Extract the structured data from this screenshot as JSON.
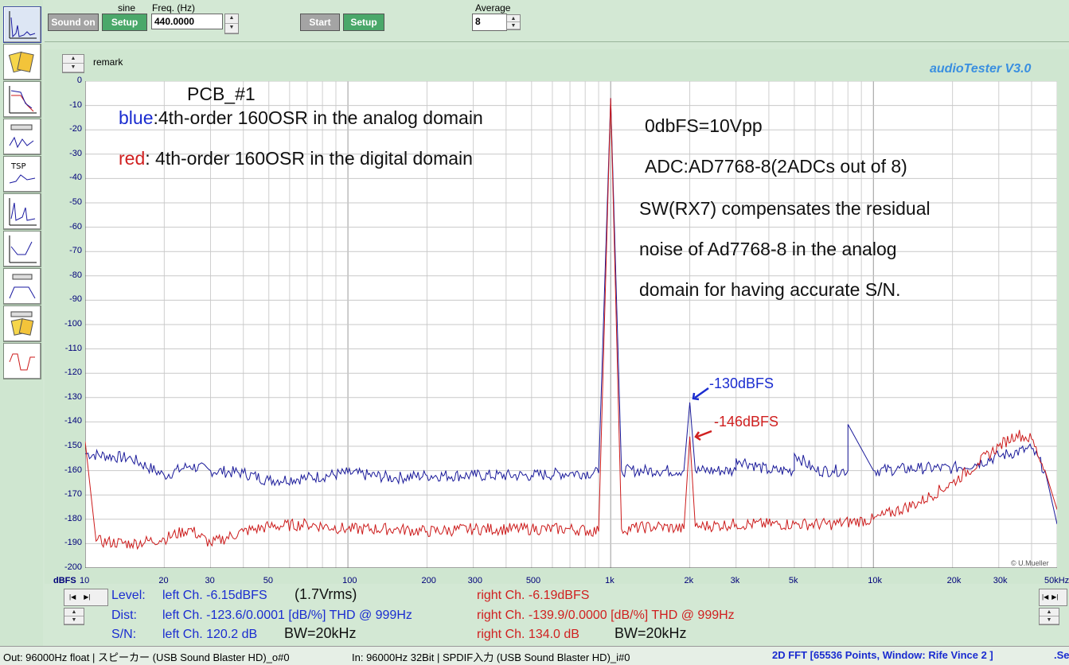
{
  "top": {
    "sound_on_label": "Sound on",
    "sine_label": "sine",
    "setup_label": "Setup",
    "freq_label": "Freq. (Hz)",
    "freq_value": "440.0000",
    "start_label": "Start",
    "setup2_label": "Setup",
    "average_label": "Average",
    "average_value": "8"
  },
  "header": {
    "remark_label": "remark",
    "app_title": "audioTester  V3.0"
  },
  "plot": {
    "y_ticks": [
      "0",
      "-10",
      "-20",
      "-30",
      "-40",
      "-50",
      "-60",
      "-70",
      "-80",
      "-90",
      "-100",
      "-110",
      "-120",
      "-130",
      "-140",
      "-150",
      "-160",
      "-170",
      "-180",
      "-190",
      "-200"
    ],
    "y_unit": "dBFS",
    "x_ticks": [
      "10",
      "20",
      "30",
      "50",
      "100",
      "200",
      "300",
      "500",
      "1k",
      "2k",
      "3k",
      "5k",
      "10k",
      "20k",
      "30k",
      "50kHz"
    ],
    "copyright": "© U.Mueller",
    "annotations": {
      "pcb": "PCB_#1",
      "blue_word": "blue",
      "blue_text": ":4th-order  160OSR in the analog domain",
      "red_word": "red",
      "red_text": ": 4th-order  160OSR in the digital domain",
      "fs": "0dbFS=10Vpp",
      "adc": "ADC:AD7768-8(2ADCs out of 8)",
      "sw1": "SW(RX7) compensates the residual",
      "sw2": "noise of Ad7768-8 in the analog",
      "sw3": "domain for having accurate S/N.",
      "blue_peak": "-130dBFS",
      "red_peak": "-146dBFS"
    }
  },
  "chart_data": {
    "type": "line",
    "title": "",
    "xlabel": "",
    "ylabel": "dBFS",
    "x_scale": "log",
    "xlim": [
      10,
      50000
    ],
    "ylim": [
      -200,
      0
    ],
    "grid": true,
    "series": [
      {
        "name": "blue",
        "color": "#1a1a9a",
        "points": [
          [
            10,
            -153
          ],
          [
            15,
            -155
          ],
          [
            20,
            -162
          ],
          [
            25,
            -158
          ],
          [
            30,
            -160
          ],
          [
            40,
            -161
          ],
          [
            50,
            -164
          ],
          [
            70,
            -163
          ],
          [
            100,
            -161
          ],
          [
            150,
            -163
          ],
          [
            200,
            -162
          ],
          [
            300,
            -162
          ],
          [
            500,
            -162
          ],
          [
            700,
            -161
          ],
          [
            900,
            -161
          ],
          [
            1000,
            -7
          ],
          [
            1100,
            -160
          ],
          [
            1500,
            -160
          ],
          [
            1900,
            -160
          ],
          [
            2000,
            -132
          ],
          [
            2100,
            -160
          ],
          [
            3000,
            -160
          ],
          [
            3000,
            -155
          ],
          [
            4000,
            -160
          ],
          [
            5000,
            -160
          ],
          [
            5000,
            -153
          ],
          [
            6000,
            -160
          ],
          [
            7000,
            -160
          ],
          [
            8000,
            -160
          ],
          [
            8000,
            -141
          ],
          [
            10000,
            -160
          ],
          [
            15000,
            -159
          ],
          [
            20000,
            -159
          ],
          [
            25000,
            -157
          ],
          [
            30000,
            -154
          ],
          [
            40000,
            -151
          ],
          [
            45000,
            -160
          ],
          [
            50000,
            -182
          ]
        ]
      },
      {
        "name": "red",
        "color": "#cc1a1a",
        "points": [
          [
            10,
            -148
          ],
          [
            11,
            -189
          ],
          [
            15,
            -190
          ],
          [
            20,
            -188
          ],
          [
            25,
            -184
          ],
          [
            30,
            -190
          ],
          [
            40,
            -185
          ],
          [
            50,
            -183
          ],
          [
            70,
            -182
          ],
          [
            100,
            -184
          ],
          [
            150,
            -184
          ],
          [
            200,
            -185
          ],
          [
            300,
            -184
          ],
          [
            500,
            -184
          ],
          [
            700,
            -184
          ],
          [
            900,
            -185
          ],
          [
            1000,
            -7
          ],
          [
            1100,
            -184
          ],
          [
            1500,
            -183
          ],
          [
            1900,
            -184
          ],
          [
            2000,
            -146
          ],
          [
            2100,
            -183
          ],
          [
            3000,
            -182
          ],
          [
            5000,
            -182
          ],
          [
            7000,
            -182
          ],
          [
            10000,
            -180
          ],
          [
            15000,
            -173
          ],
          [
            20000,
            -165
          ],
          [
            25000,
            -157
          ],
          [
            30000,
            -150
          ],
          [
            35000,
            -145
          ],
          [
            40000,
            -147
          ],
          [
            45000,
            -160
          ],
          [
            50000,
            -176
          ]
        ]
      }
    ]
  },
  "measurements": {
    "level_label": "Level:",
    "level_left": "left Ch. -6.15dBFS",
    "level_left_rms": "(1.7Vrms)",
    "level_right": "right Ch. -6.19dBFS",
    "dist_label": "Dist:",
    "dist_left": "left Ch. -123.6/0.0001 [dB/%] THD @ 999Hz",
    "dist_right": "right Ch. -139.9/0.0000 [dB/%] THD @ 999Hz",
    "sn_label": "S/N:",
    "sn_left": "left Ch. 120.2 dB",
    "sn_left_bw": "BW=20kHz",
    "sn_right": "right Ch. 134.0 dB",
    "sn_right_bw": "BW=20kHz"
  },
  "status": {
    "out": "Out: 96000Hz float  | スピーカー (USB Sound Blaster HD)_o#0",
    "in": "In: 96000Hz 32Bit  | SPDIF入力 (USB Sound Blaster HD)_i#0",
    "mode": "2D FFT [65536 Points, Window: Rife Vince 2 ]",
    "se": ".Se"
  }
}
